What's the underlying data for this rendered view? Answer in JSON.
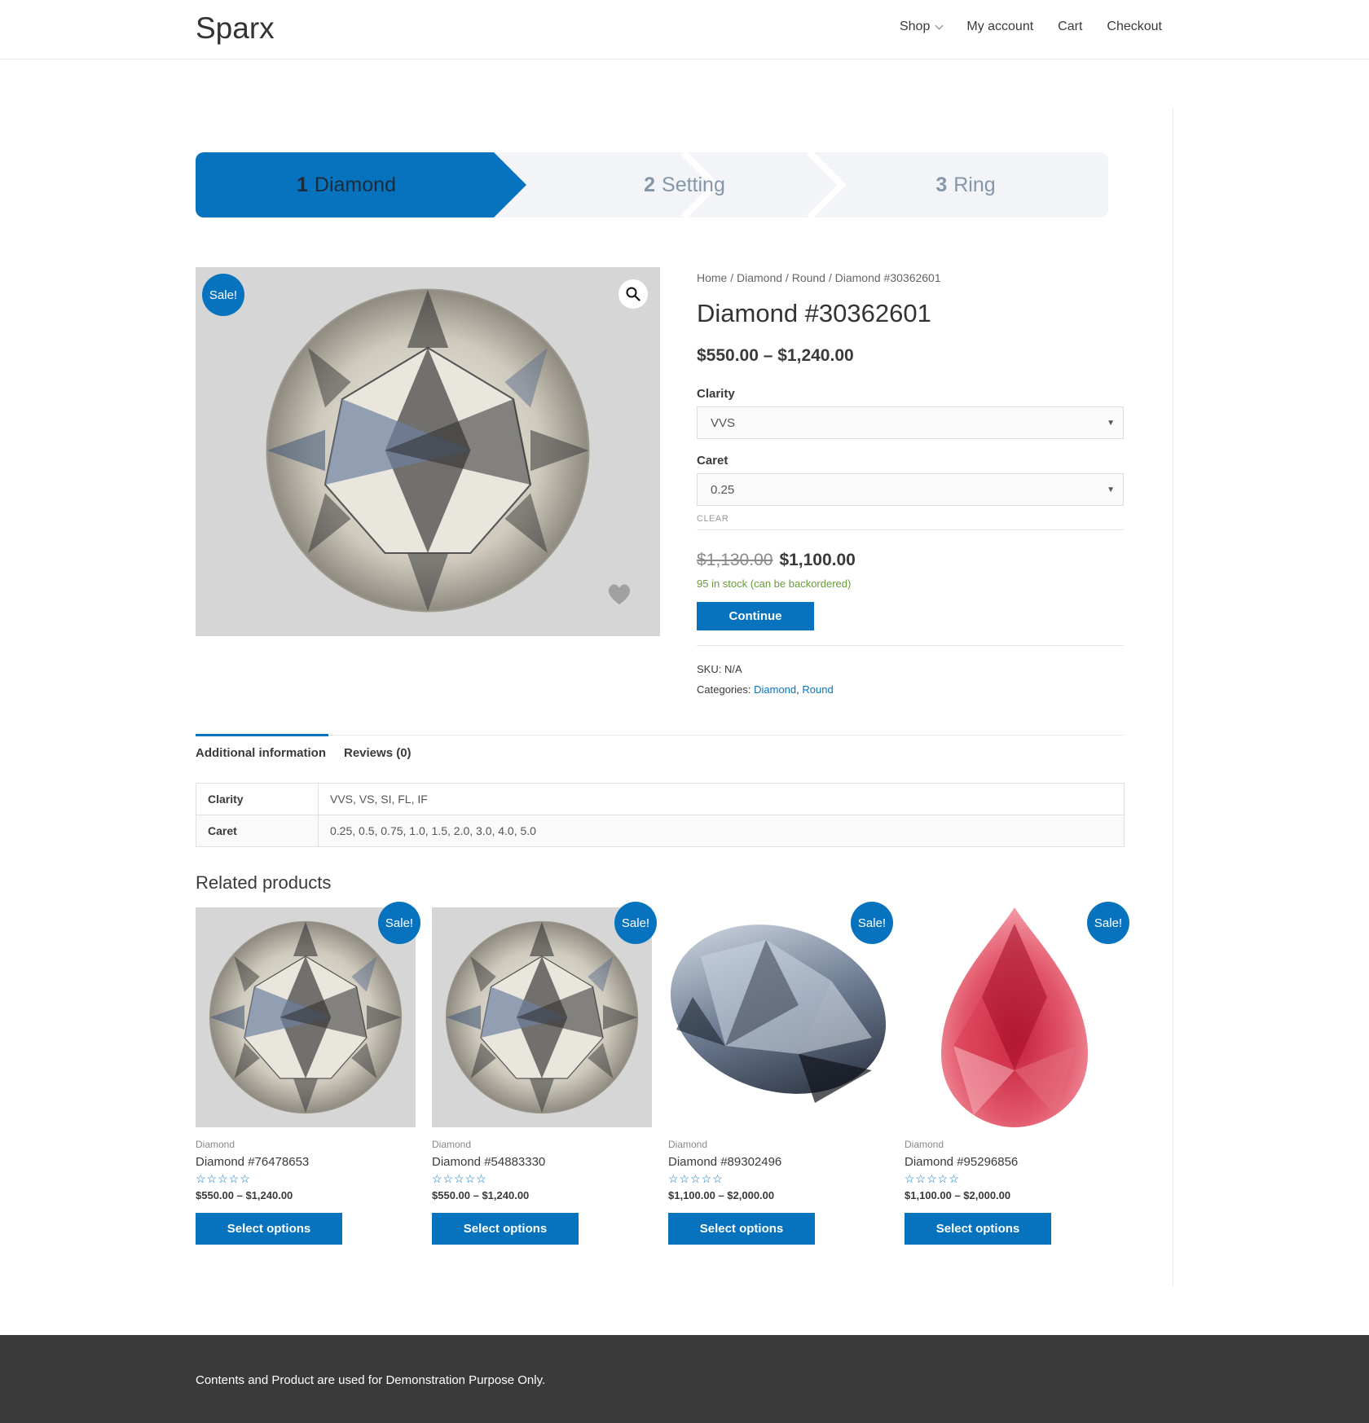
{
  "site": {
    "title": "Sparx"
  },
  "nav": {
    "shop": "Shop",
    "account": "My account",
    "cart": "Cart",
    "checkout": "Checkout"
  },
  "steps": [
    {
      "num": "1",
      "label": "Diamond"
    },
    {
      "num": "2",
      "label": "Setting"
    },
    {
      "num": "3",
      "label": "Ring"
    }
  ],
  "product": {
    "sale_badge": "Sale!",
    "breadcrumb": "Home / Diamond / Round / Diamond #30362601",
    "title": "Diamond #30362601",
    "price_range": "$550.00 – $1,240.00",
    "clarity_label": "Clarity",
    "clarity_value": "VVS",
    "caret_label": "Caret",
    "caret_value": "0.25",
    "clear": "CLEAR",
    "old_price": "$1,130.00",
    "new_price": "$1,100.00",
    "stock": "95 in stock (can be backordered)",
    "continue": "Continue",
    "sku_label": "SKU:",
    "sku": "N/A",
    "categories_label": "Categories:",
    "category_1": "Diamond",
    "category_2": "Round"
  },
  "tabs": {
    "additional": "Additional information",
    "reviews": "Reviews (0)"
  },
  "attributes": [
    {
      "name": "Clarity",
      "value": "VVS, VS, SI, FL, IF"
    },
    {
      "name": "Caret",
      "value": "0.25, 0.5, 0.75, 1.0, 1.5, 2.0, 3.0, 4.0, 5.0"
    }
  ],
  "related": {
    "title": "Related products",
    "items": [
      {
        "badge": "Sale!",
        "category": "Diamond",
        "title": "Diamond #76478653",
        "stars": "☆☆☆☆☆",
        "price": "$550.00 – $1,240.00",
        "button": "Select options"
      },
      {
        "badge": "Sale!",
        "category": "Diamond",
        "title": "Diamond #54883330",
        "stars": "☆☆☆☆☆",
        "price": "$550.00 – $1,240.00",
        "button": "Select options"
      },
      {
        "badge": "Sale!",
        "category": "Diamond",
        "title": "Diamond #89302496",
        "stars": "☆☆☆☆☆",
        "price": "$1,100.00 – $2,000.00",
        "button": "Select options"
      },
      {
        "badge": "Sale!",
        "category": "Diamond",
        "title": "Diamond #95296856",
        "stars": "☆☆☆☆☆",
        "price": "$1,100.00 – $2,000.00",
        "button": "Select options"
      }
    ]
  },
  "footer": {
    "text": "Contents and Product are used for Demonstration Purpose Only."
  },
  "colors": {
    "accent": "#0773bf",
    "footer": "#3a3a3a",
    "stock": "#6a9a3e"
  }
}
